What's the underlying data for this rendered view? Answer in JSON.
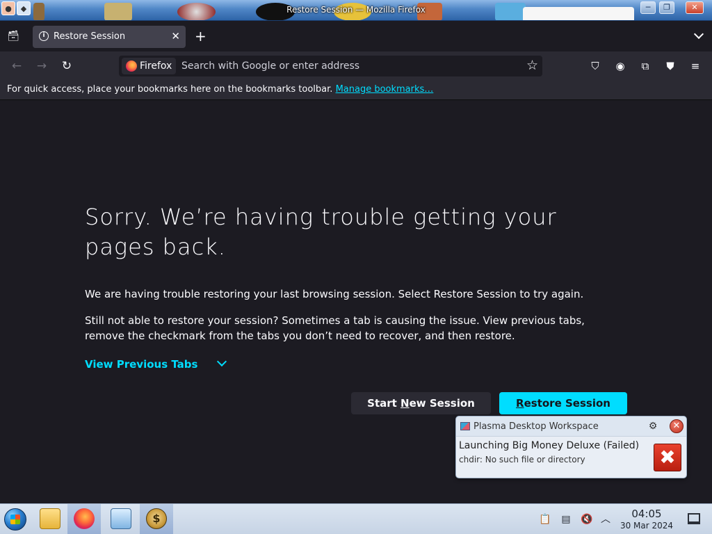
{
  "window": {
    "title": "Restore Session — Mozilla Firefox"
  },
  "tabs": {
    "active_title": "Restore Session",
    "close_glyph": "✕",
    "new_tab_glyph": "+"
  },
  "nav": {
    "identity_label": "Firefox",
    "url_placeholder": "Search with Google or enter address",
    "back_glyph": "←",
    "forward_glyph": "→",
    "reload_glyph": "↻",
    "star_glyph": "☆"
  },
  "toolbar_icons": [
    "pocket-icon",
    "account-icon",
    "extensions-icon",
    "ublock-icon",
    "menu-icon"
  ],
  "bookmarks": {
    "hint": "For quick access, place your bookmarks here on the bookmarks toolbar. ",
    "link": "Manage bookmarks…"
  },
  "content": {
    "heading": "Sorry. We’re having trouble getting your pages back.",
    "para1": "We are having trouble restoring your last browsing session. Select Restore Session to try again.",
    "para2": "Still not able to restore your session? Sometimes a tab is causing the issue. View previous tabs, remove the checkmark from the tabs you don’t need to recover, and then restore.",
    "view_tabs": "View Previous Tabs",
    "new_session": {
      "pre": "Start ",
      "u": "N",
      "post": "ew Session"
    },
    "restore_session": {
      "pre": "",
      "u": "R",
      "post": "estore Session"
    }
  },
  "notification": {
    "app": "Plasma Desktop Workspace",
    "title": "Launching Big Money Deluxe (Failed)",
    "text": "chdir: No such file or directory"
  },
  "taskbar": {
    "time": "04:05",
    "date": "30 Mar 2024"
  },
  "colors": {
    "accent": "#00ddff",
    "background": "#1c1b22",
    "toolbar": "#2b2a33"
  }
}
